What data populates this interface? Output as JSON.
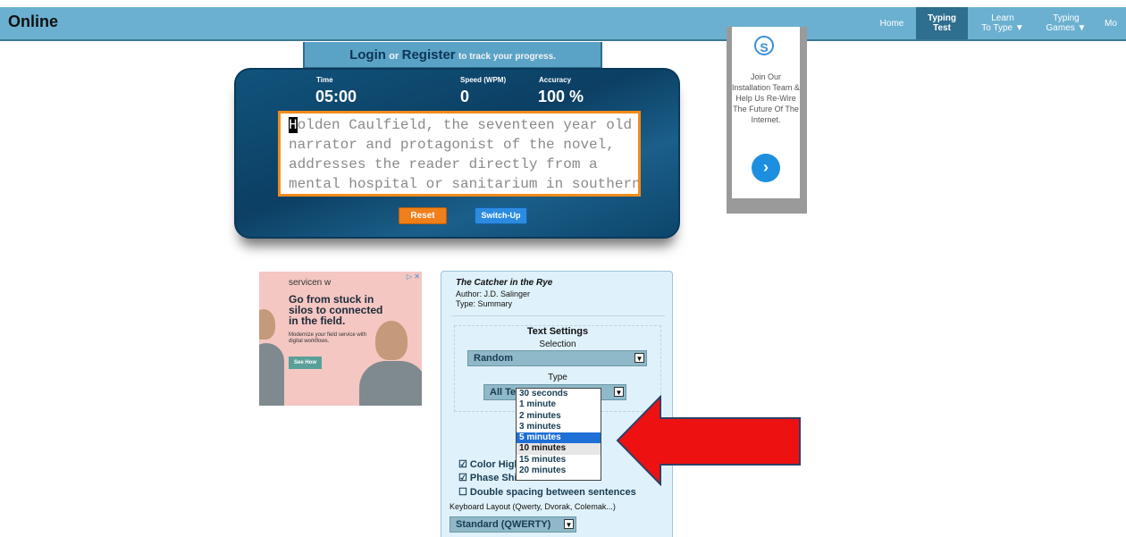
{
  "nav": {
    "brand": "Online",
    "items": [
      {
        "label": "Home",
        "active": false
      },
      {
        "label": "Typing\nTest",
        "active": true
      },
      {
        "label": "Learn\nTo Type ▼",
        "active": false
      },
      {
        "label": "Typing\nGames ▼",
        "active": false
      },
      {
        "label": "Mo",
        "active": false
      }
    ]
  },
  "login": {
    "login_label": "Login",
    "or_label": "or",
    "register_label": "Register",
    "track_label": "to track your progress."
  },
  "stats": {
    "time_label": "Time",
    "time_value": "05:00",
    "speed_label": "Speed (WPM)",
    "speed_value": "0",
    "accuracy_label": "Accuracy",
    "accuracy_value": "100 %"
  },
  "typing_text": {
    "cursor_char": "H",
    "lines": [
      "olden Caulfield, the seventeen year old",
      "narrator and protagonist of the novel,",
      "addresses the reader directly from a",
      "mental hospital or sanitarium in southern"
    ]
  },
  "buttons": {
    "reset": "Reset",
    "switch_up": "Switch-Up"
  },
  "ad_right": {
    "logo": "S",
    "text": "Join Our Installation Team & Help Us Re-Wire The Future Of The Internet.",
    "arrow": "›"
  },
  "ad_left": {
    "brand": "servicen  w",
    "headline": "Go from stuck in silos to connected in the field.",
    "subtext": "Modernize your field service with digital workflows.",
    "cta": "See How",
    "close": "▷ ✕"
  },
  "settings": {
    "book_title": "The Catcher in the Rye",
    "author": "Author: J.D. Salinger",
    "type": "Type: Summary",
    "text_settings_title": "Text Settings",
    "selection_label": "Selection",
    "selection_value": "Random",
    "type_label": "Type",
    "type_value": "All Te",
    "checkboxes": [
      {
        "label": "Color High",
        "checked": true
      },
      {
        "label": "Phase Shi",
        "checked": true
      },
      {
        "label": "Double spacing between sentences",
        "checked": false
      }
    ],
    "keyboard_label": "Keyboard Layout (Qwerty, Dvorak, Colemak...)",
    "keyboard_value": "Standard (QWERTY)"
  },
  "duration_dropdown": {
    "options": [
      "30 seconds",
      "1 minute",
      "2 minutes",
      "3 minutes",
      "5 minutes",
      "10 minutes",
      "15 minutes",
      "20 minutes"
    ],
    "selected": "5 minutes",
    "hovered": "10 minutes"
  },
  "colors": {
    "nav_bg": "#6bb0d0",
    "panel_bg": "#0c3f63",
    "reset_btn": "#f07f1a",
    "switch_btn": "#2b8be0",
    "dropdown_selected": "#1e6fd6",
    "arrow": "#ee1111"
  }
}
